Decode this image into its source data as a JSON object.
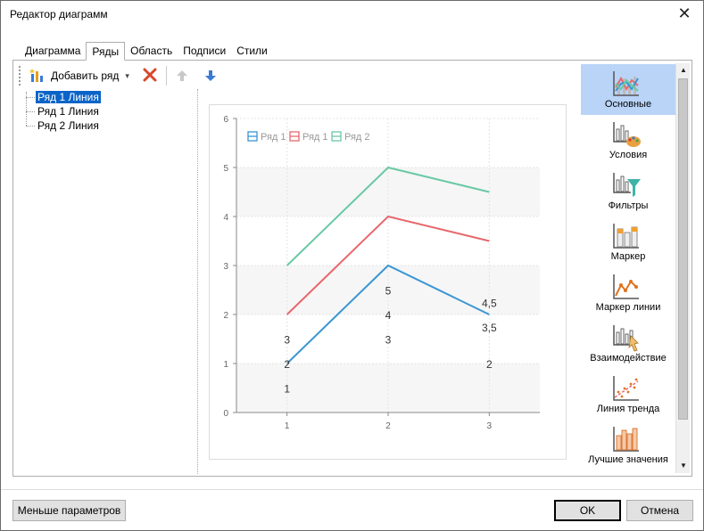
{
  "window": {
    "title": "Редактор диаграмм"
  },
  "tabs": [
    "Диаграмма",
    "Ряды",
    "Область",
    "Подписи",
    "Стили"
  ],
  "toolbar": {
    "add_label": "Добавить ряд"
  },
  "tree": {
    "items": [
      "Ряд 1 Линия",
      "Ряд 1 Линия",
      "Ряд 2 Линия"
    ]
  },
  "side_panel": {
    "items": [
      "Основные",
      "Условия",
      "Фильтры",
      "Маркер",
      "Маркер линии",
      "Взаимодействие",
      "Линия тренда",
      "Лучшие значения"
    ]
  },
  "buttons": {
    "fewer_params": "Меньше параметров",
    "ok": "OK",
    "cancel": "Отмена"
  },
  "colors": {
    "series1": "#3a96d4",
    "series2": "#e8686d",
    "series3": "#69c9a4",
    "selection": "#0a64c8",
    "active_panel": "#b9d4f7"
  },
  "chart_data": {
    "type": "line",
    "x": [
      1,
      2,
      3
    ],
    "ylim": [
      0,
      6
    ],
    "y_ticks": [
      0,
      1,
      2,
      3,
      4,
      5,
      6
    ],
    "grid": true,
    "legend": "top-left",
    "series": [
      {
        "name": "Ряд 1",
        "values": [
          1,
          3,
          2
        ],
        "color": "#3a96d4"
      },
      {
        "name": "Ряд 1",
        "values": [
          2,
          4,
          3.5
        ],
        "color": "#e8686d"
      },
      {
        "name": "Ряд 2",
        "values": [
          3,
          5,
          4.5
        ],
        "color": "#69c9a4"
      }
    ],
    "data_labels": [
      {
        "x": 1,
        "y": 0.5,
        "text": "1"
      },
      {
        "x": 1,
        "y": 1,
        "text": "2"
      },
      {
        "x": 1,
        "y": 1.5,
        "text": "3"
      },
      {
        "x": 2,
        "y": 1.5,
        "text": "3"
      },
      {
        "x": 2,
        "y": 2,
        "text": "4"
      },
      {
        "x": 2,
        "y": 2.5,
        "text": "5"
      },
      {
        "x": 3,
        "y": 1,
        "text": "2"
      },
      {
        "x": 3,
        "y": 1.75,
        "text": "3,5"
      },
      {
        "x": 3,
        "y": 2.25,
        "text": "4,5"
      }
    ]
  }
}
